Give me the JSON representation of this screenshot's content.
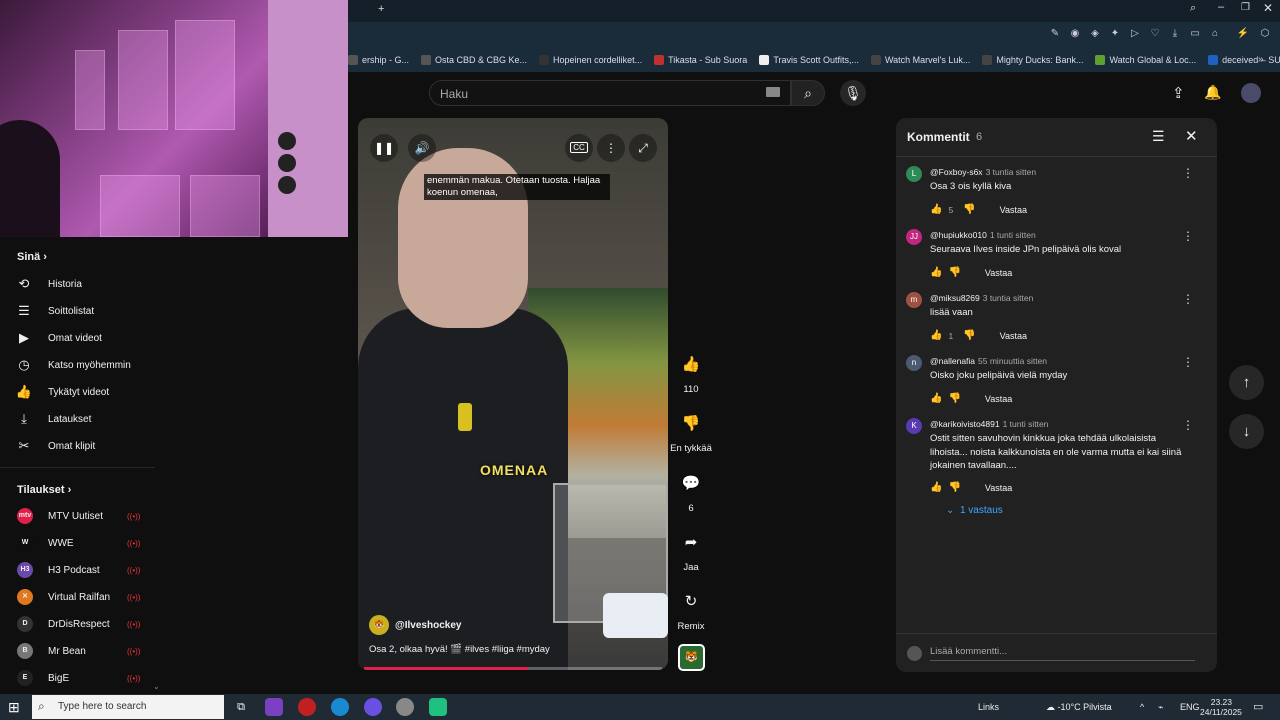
{
  "browser": {
    "bookmarks": [
      {
        "label": "ership - G...",
        "color": "#555"
      },
      {
        "label": "Osta CBD & CBG Ke...",
        "color": "#555"
      },
      {
        "label": "Hopeinen cordelliket...",
        "color": "#333"
      },
      {
        "label": "Tikasta - Sub Suora",
        "color": "#c03030"
      },
      {
        "label": "Travis Scott Outfits,...",
        "color": "#eee"
      },
      {
        "label": "Watch Marvel's Luk...",
        "color": "#444"
      },
      {
        "label": "Mighty Ducks: Bank...",
        "color": "#444"
      },
      {
        "label": "Watch Global & Loc...",
        "color": "#60a030"
      },
      {
        "label": "deceived – SUORAT...",
        "color": "#2060c0"
      }
    ]
  },
  "header": {
    "search_placeholder": "Haku",
    "icons": [
      "keyboard-icon",
      "search-icon",
      "microphone-icon",
      "upload-icon",
      "bell-icon",
      "avatar"
    ]
  },
  "sidebar": {
    "you_title": "Sinä",
    "you_items": [
      {
        "label": "Historia",
        "icon": "history-icon"
      },
      {
        "label": "Soittolistat",
        "icon": "playlist-icon"
      },
      {
        "label": "Omat videot",
        "icon": "video-icon"
      },
      {
        "label": "Katso myöhemmin",
        "icon": "clock-icon"
      },
      {
        "label": "Tykätyt videot",
        "icon": "thumb-up-icon"
      },
      {
        "label": "Lataukset",
        "icon": "download-icon"
      },
      {
        "label": "Omat klipit",
        "icon": "scissors-icon"
      }
    ],
    "subs_title": "Tilaukset",
    "subs": [
      {
        "label": "MTV Uutiset",
        "color": "#e0204a",
        "abbr": "mtv"
      },
      {
        "label": "WWE",
        "color": "#0f0f0f",
        "abbr": "W"
      },
      {
        "label": "H3 Podcast",
        "color": "#6a4aa8",
        "abbr": "H3"
      },
      {
        "label": "Virtual Railfan",
        "color": "#e07820",
        "abbr": "✕"
      },
      {
        "label": "DrDisRespect",
        "color": "#333",
        "abbr": "D"
      },
      {
        "label": "Mr Bean",
        "color": "#777",
        "abbr": "B"
      },
      {
        "label": "BigE",
        "color": "#222",
        "abbr": "E"
      }
    ]
  },
  "video": {
    "caption": "enemmän makua. Otetaan tuosta. Haljaa koenun omenaa,",
    "overlay_text": "OMENAA",
    "channel": "@Ilveshockey",
    "title": "Osa 2, olkaa hyvä! 🎬 #ilves #liiga #myday",
    "progress": 0.55,
    "cc_label": "CC"
  },
  "actions": {
    "likes": "110",
    "dislike_label": "En tykkää",
    "comments": "6",
    "share_label": "Jaa",
    "remix_label": "Remix"
  },
  "comments": {
    "title": "Kommentit",
    "count": "6",
    "items": [
      {
        "author": "@Foxboy-s6x",
        "time": "3 tuntia sitten",
        "text": "Osa 3 ois kyllä kiva",
        "likes": "5",
        "reply": "Vastaa",
        "avatar_color": "#2e8b57",
        "avatar_letter": "L"
      },
      {
        "author": "@hupiukko010",
        "time": "1 tunti sitten",
        "text": "Seuraava Ilves inside JPn pelipäivä olis koval",
        "likes": "",
        "reply": "Vastaa",
        "avatar_color": "#c02880",
        "avatar_letter": "JJ"
      },
      {
        "author": "@miksu8269",
        "time": "3 tuntia sitten",
        "text": "lisää vaan",
        "likes": "1",
        "reply": "Vastaa",
        "avatar_color": "#a05040",
        "avatar_letter": "m"
      },
      {
        "author": "@nallenafia",
        "time": "55 minuuttia sitten",
        "text": "Oisko joku pelipäivä vielä myday",
        "likes": "",
        "reply": "Vastaa",
        "avatar_color": "#4a5a70",
        "avatar_letter": "n"
      },
      {
        "author": "@karikoivisto4891",
        "time": "1 tunti sitten",
        "text": "Ostit sitten savuhovin kinkkua joka tehdää ulkolaisista lihoista... noista kalkkunoista en ole varma mutta ei kai siinä jokainen tavallaan....",
        "likes": "",
        "reply": "Vastaa",
        "avatar_color": "#5a3ab0",
        "avatar_letter": "K"
      }
    ],
    "replies_label": "1 vastaus",
    "input_placeholder": "Lisää kommentti..."
  },
  "taskbar": {
    "search_placeholder": "Type here to search",
    "links": "Links",
    "weather": "-10°C  Pilvista",
    "lang": "ENG",
    "time": "23.23",
    "date": "24/11/2025"
  }
}
